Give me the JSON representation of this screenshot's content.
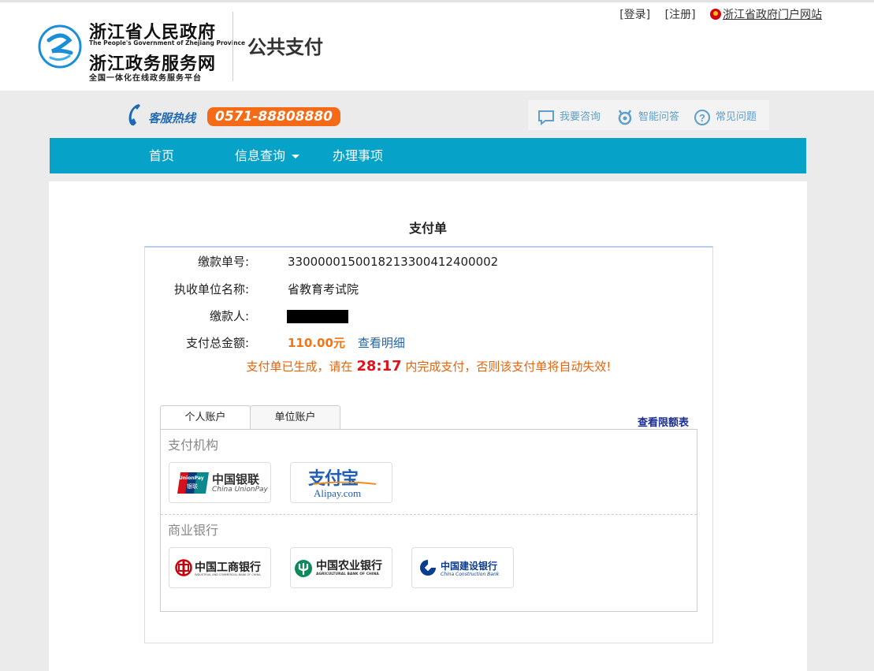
{
  "header": {
    "logo_line1": "浙江省人民政府",
    "logo_line2": "The People's Government of Zhejiang Province",
    "logo_line3": "浙江政务服务网",
    "logo_line4": "全国一体化在线政务服务平台",
    "site_title": "公共支付",
    "login": "[登录]",
    "register": "[注册]",
    "portal": "浙江省政府门户网站"
  },
  "hotline": {
    "label": "客服热线",
    "number": "0571-88808880"
  },
  "help": {
    "consult": "我要咨询",
    "smart_qa": "智能问答",
    "faq": "常见问题"
  },
  "nav": {
    "home": "首页",
    "query": "信息查询",
    "services": "办理事项"
  },
  "order": {
    "title": "支付单",
    "fields": [
      {
        "label": "缴款单号:",
        "value": "3300000150018213300412400002"
      },
      {
        "label": "执收单位名称:",
        "value": "省教育考试院"
      },
      {
        "label": "缴款人:",
        "value": ""
      },
      {
        "label": "支付总金额:",
        "value": "110.00元"
      }
    ],
    "detail_link": "查看明细",
    "notice_before": "支付单已生成，请在",
    "timer": "28:17",
    "notice_after": "内完成支付，否则该支付单将自动失效!"
  },
  "tabs": {
    "personal": "个人账户",
    "corporate": "单位账户",
    "limit_link": "查看限额表"
  },
  "payment": {
    "institutions_label": "支付机构",
    "banks_label": "商业银行",
    "unionpay": {
      "badge_top": "UnionPay",
      "badge_bottom": "银联",
      "cn": "中国银联",
      "en": "China UnionPay"
    },
    "alipay": {
      "cn": "支付宝",
      "en": "Alipay.com"
    },
    "icbc": {
      "cn": "中国工商银行",
      "en": "INDUSTRIAL AND COMMERCIAL BANK OF CHINA"
    },
    "abc": {
      "cn": "中国农业银行",
      "en": "AGRICULTURAL BANK OF CHINA"
    },
    "ccb": {
      "cn": "中国建设银行",
      "en": "China Construction Bank"
    }
  },
  "colors": {
    "nav_bg": "#07a2c8",
    "hotline_bg": "#f56a17",
    "amount": "#f5740f",
    "timer": "#e0111b",
    "link": "#1a64b0"
  }
}
